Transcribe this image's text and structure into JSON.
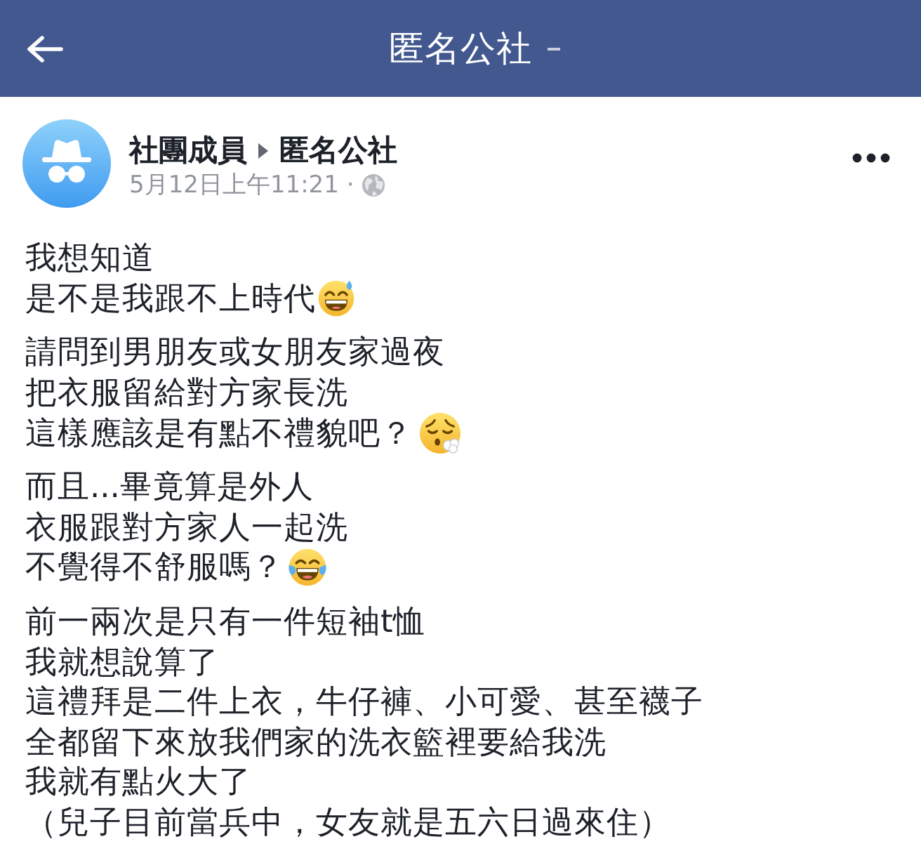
{
  "top_bar": {
    "title": "匿名公社"
  },
  "post": {
    "author": "社團成員",
    "group": "匿名公社",
    "timestamp": "5月12日上午11:21 ·"
  },
  "paragraphs": [
    {
      "lines": [
        {
          "kind": "text",
          "text": "我想知道"
        },
        {
          "kind": "grin",
          "text": "是不是我跟不上時代"
        }
      ]
    },
    {
      "lines": [
        {
          "kind": "text",
          "text": "請問到男朋友或女朋友家過夜"
        },
        {
          "kind": "text",
          "text": "把衣服留給對方家長洗"
        },
        {
          "kind": "sigh",
          "text": "這樣應該是有點不禮貌吧？"
        }
      ]
    },
    {
      "lines": [
        {
          "kind": "text",
          "text": "而且...畢竟算是外人"
        },
        {
          "kind": "text",
          "text": "衣服跟對方家人一起洗"
        },
        {
          "kind": "joy",
          "text": "不覺得不舒服嗎？"
        }
      ]
    },
    {
      "lines": [
        {
          "kind": "text",
          "text": "前一兩次是只有一件短袖t恤"
        },
        {
          "kind": "text",
          "text": "我就想說算了"
        },
        {
          "kind": "text",
          "text": "這禮拜是二件上衣，牛仔褲、小可愛、甚至襪子"
        },
        {
          "kind": "text",
          "text": "全都留下來放我們家的洗衣籃裡要給我洗"
        },
        {
          "kind": "text",
          "text": "我就有點火大了"
        },
        {
          "kind": "text",
          "text": "（兒子目前當兵中，女友就是五六日過來住）"
        }
      ]
    }
  ]
}
